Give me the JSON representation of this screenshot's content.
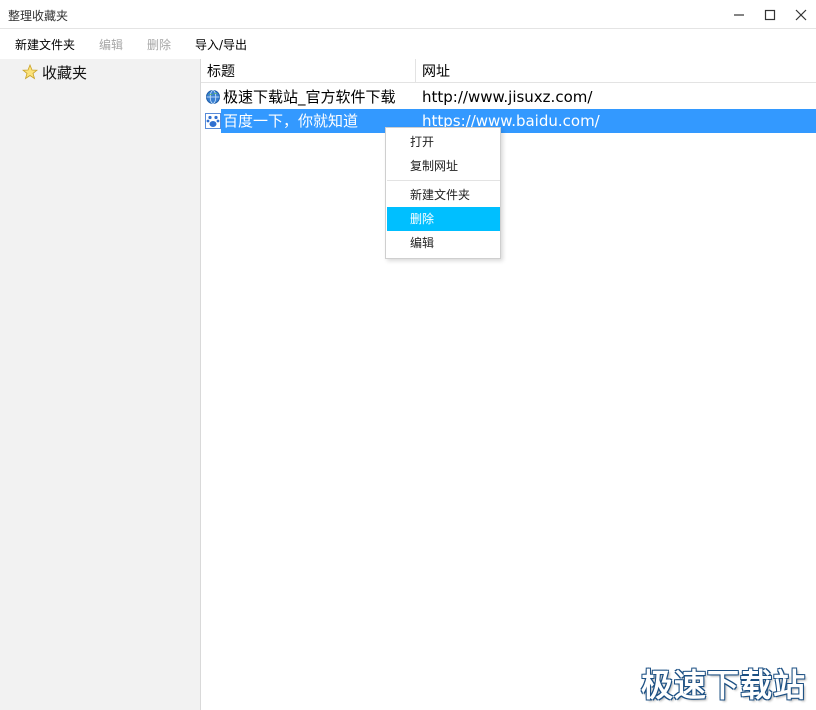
{
  "window": {
    "title": "整理收藏夹",
    "controls": [
      "minimize-icon",
      "maximize-icon",
      "close-icon"
    ]
  },
  "toolbar": {
    "new_folder": "新建文件夹",
    "edit": "编辑",
    "delete": "删除",
    "import_export": "导入/导出"
  },
  "sidebar": {
    "root": {
      "label": "收藏夹",
      "icon": "star-icon"
    }
  },
  "list": {
    "columns": {
      "title": "标题",
      "url": "网址"
    },
    "rows": [
      {
        "title": "极速下载站_官方软件下载",
        "url": "http://www.jisuxz.com/",
        "icon": "globe-icon",
        "selected": false
      },
      {
        "title": "百度一下，你就知道",
        "url": "https://www.baidu.com/",
        "icon": "baidu-paw-icon",
        "selected": true
      }
    ]
  },
  "context_menu": {
    "items": [
      {
        "label": "打开"
      },
      {
        "label": "复制网址"
      },
      {
        "label": "新建文件夹"
      },
      {
        "label": "删除",
        "highlighted": true
      },
      {
        "label": "编辑"
      }
    ]
  },
  "watermark": "极速下载站",
  "colors": {
    "selection": "#3399ff",
    "menu_highlight": "#00bfff",
    "sidebar_bg": "#f2f2f2"
  }
}
